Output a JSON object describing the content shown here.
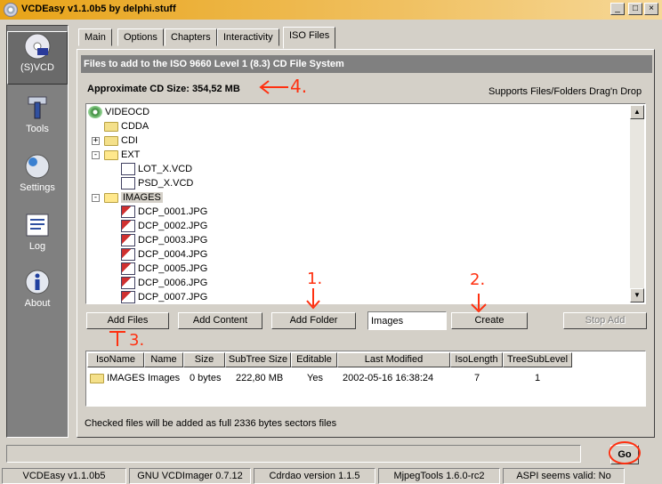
{
  "window": {
    "title": "VCDEasy v1.1.0b5 by delphi.stuff"
  },
  "sidebar": {
    "items": [
      {
        "label": "(S)VCD",
        "icon": "disc-icon"
      },
      {
        "label": "Tools",
        "icon": "tools-icon"
      },
      {
        "label": "Settings",
        "icon": "settings-icon"
      },
      {
        "label": "Log",
        "icon": "log-icon"
      },
      {
        "label": "About",
        "icon": "about-icon"
      }
    ]
  },
  "tabs": [
    "Main",
    "Options",
    "Chapters",
    "Interactivity",
    "ISO Files"
  ],
  "panel": {
    "header": "Files to add to the ISO 9660 Level 1 (8.3) CD File System",
    "cd_size": "Approximate CD Size:  354,52 MB",
    "dragdrop_note": "Supports Files/Folders Drag'n Drop"
  },
  "tree": {
    "items": [
      {
        "label": "VIDEOCD"
      },
      {
        "label": "CDDA"
      },
      {
        "label": "CDI"
      },
      {
        "label": "EXT"
      },
      {
        "label": "LOT_X.VCD"
      },
      {
        "label": "PSD_X.VCD"
      },
      {
        "label": "IMAGES"
      },
      {
        "label": "DCP_0001.JPG"
      },
      {
        "label": "DCP_0002.JPG"
      },
      {
        "label": "DCP_0003.JPG"
      },
      {
        "label": "DCP_0004.JPG"
      },
      {
        "label": "DCP_0005.JPG"
      },
      {
        "label": "DCP_0006.JPG"
      },
      {
        "label": "DCP_0007.JPG"
      }
    ]
  },
  "actions": {
    "add_files": "Add Files",
    "add_content": "Add Content",
    "add_folder": "Add Folder",
    "folder_name": "Images",
    "create": "Create",
    "stop_add": "Stop Add"
  },
  "table": {
    "columns": [
      "IsoName",
      "Name",
      "Size",
      "SubTree Size",
      "Editable",
      "Last Modified",
      "IsoLength",
      "TreeSubLevel"
    ],
    "rows": [
      [
        "IMAGES",
        "Images",
        "0 bytes",
        "222,80 MB",
        "Yes",
        "2002-05-16 16:38:24",
        "7",
        "1"
      ]
    ]
  },
  "note": "Checked files will be added as full 2336 bytes sectors files",
  "go_label": "Go",
  "status": [
    "VCDEasy v1.1.0b5",
    "GNU VCDImager 0.7.12",
    "Cdrdao version 1.1.5",
    "MjpegTools 1.6.0-rc2",
    "ASPI seems valid: No"
  ],
  "annotations": [
    "1.",
    "2.",
    "3.",
    "4."
  ],
  "colors": {
    "annotation": "#ff3010",
    "header_bg": "#808080",
    "titlebar": "#e8a317"
  }
}
